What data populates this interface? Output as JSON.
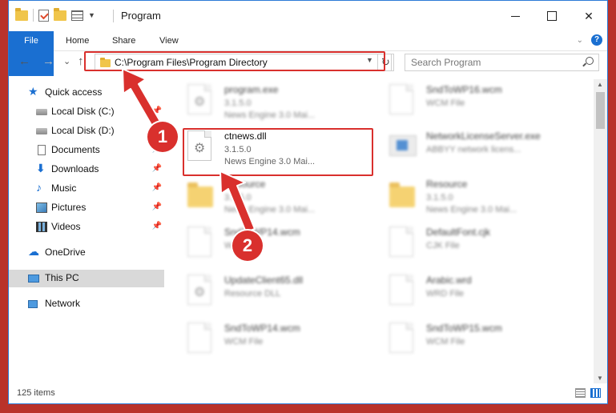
{
  "window": {
    "title": "Program",
    "controls": {
      "minimize": "—",
      "maximize": "☐",
      "close": "✕"
    }
  },
  "ribbon": {
    "tabs": [
      {
        "label": "File"
      },
      {
        "label": "Home"
      },
      {
        "label": "Share"
      },
      {
        "label": "View"
      }
    ],
    "help": "?"
  },
  "navbar": {
    "back": "←",
    "forward": "→",
    "recent": "⌄",
    "up": "↑",
    "address": "C:\\Program Files\\Program Directory",
    "refresh": "↻",
    "search_placeholder": "Search Program"
  },
  "sidebar": {
    "items": [
      {
        "label": "Quick access"
      },
      {
        "label": "Local Disk (C:)"
      },
      {
        "label": "Local Disk (D:)"
      },
      {
        "label": "Documents"
      },
      {
        "label": "Downloads"
      },
      {
        "label": "Music"
      },
      {
        "label": "Pictures"
      },
      {
        "label": "Videos"
      },
      {
        "label": "OneDrive"
      },
      {
        "label": "This PC"
      },
      {
        "label": "Network"
      }
    ]
  },
  "files": [
    {
      "name": "program.exe",
      "version": "3.1.5.0",
      "desc": "News Engine 3.0 Mai..."
    },
    {
      "name": "SndToWP16.wcm",
      "version": "WCM File",
      "desc": ""
    },
    {
      "name": "ctnews.dll",
      "version": "3.1.5.0",
      "desc": "News Engine 3.0 Mai..."
    },
    {
      "name": "NetworkLicenseServer.exe",
      "version": "ABBYY network licens...",
      "desc": ""
    },
    {
      "name": "Resource",
      "version": "3.1.5.0",
      "desc": "News Engine 3.0 Mai..."
    },
    {
      "name": "Resource",
      "version": "3.1.5.0",
      "desc": "News Engine 3.0 Mai..."
    },
    {
      "name": "SndToWP14.wcm",
      "version": "WCM File",
      "desc": ""
    },
    {
      "name": "DefaultFont.cjk",
      "version": "CJK File",
      "desc": ""
    },
    {
      "name": "UpdateClient65.dll",
      "version": "Resource DLL",
      "desc": ""
    },
    {
      "name": "Arabic.wrd",
      "version": "WRD File",
      "desc": ""
    },
    {
      "name": "SndToWP14.wcm",
      "version": "WCM File",
      "desc": ""
    },
    {
      "name": "SndToWP15.wcm",
      "version": "WCM File",
      "desc": ""
    }
  ],
  "status": {
    "item_count": "125 items"
  },
  "annotations": {
    "badge1": "1",
    "badge2": "2"
  },
  "colors": {
    "accent": "#1a6fd1",
    "annotation": "#d9302d"
  }
}
